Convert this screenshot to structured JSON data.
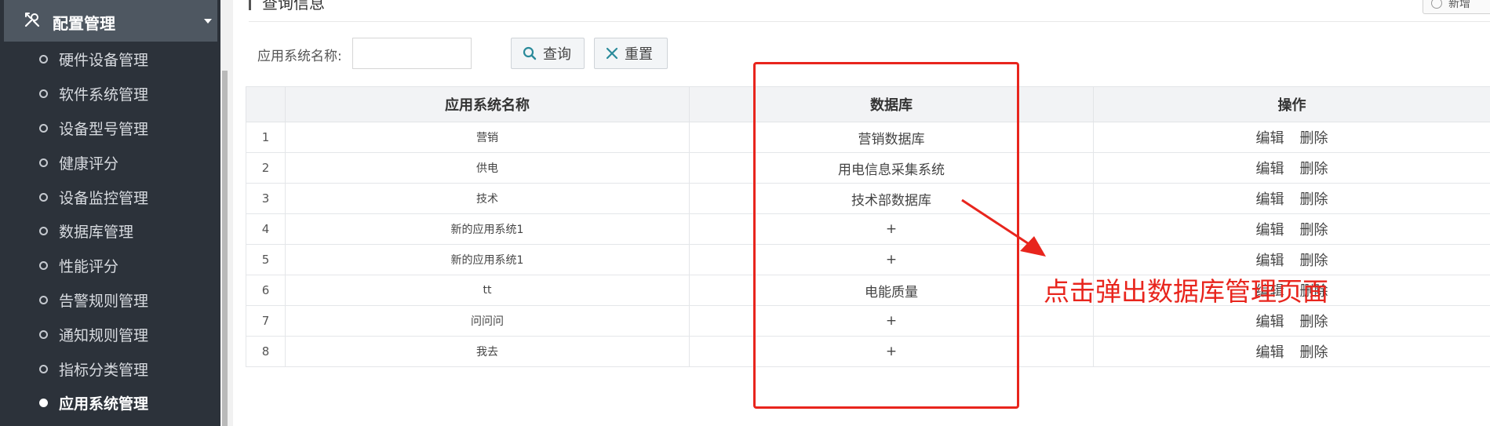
{
  "sidebar": {
    "header_label": "配置管理",
    "items": [
      {
        "label": "硬件设备管理",
        "active": false
      },
      {
        "label": "软件系统管理",
        "active": false
      },
      {
        "label": "设备型号管理",
        "active": false
      },
      {
        "label": "健康评分",
        "active": false
      },
      {
        "label": "设备监控管理",
        "active": false
      },
      {
        "label": "数据库管理",
        "active": false
      },
      {
        "label": "性能评分",
        "active": false
      },
      {
        "label": "告警规则管理",
        "active": false
      },
      {
        "label": "通知规则管理",
        "active": false
      },
      {
        "label": "指标分类管理",
        "active": false
      },
      {
        "label": "应用系统管理",
        "active": true
      }
    ]
  },
  "main": {
    "section_title": "查询信息",
    "add_label": "新增",
    "search": {
      "label": "应用系统名称:",
      "value": "",
      "placeholder": ""
    },
    "query_label": "查询",
    "reset_label": "重置"
  },
  "table": {
    "headers": [
      "",
      "应用系统名称",
      "数据库",
      "操作"
    ],
    "rows": [
      {
        "idx": "1",
        "name": "营销",
        "db": "营销数据库"
      },
      {
        "idx": "2",
        "name": "供电",
        "db": "用电信息采集系统"
      },
      {
        "idx": "3",
        "name": "技术",
        "db": "技术部数据库"
      },
      {
        "idx": "4",
        "name": "新的应用系统1",
        "db": "+"
      },
      {
        "idx": "5",
        "name": "新的应用系统1",
        "db": "+"
      },
      {
        "idx": "6",
        "name": "tt",
        "db": "电能质量"
      },
      {
        "idx": "7",
        "name": "问问问",
        "db": "+"
      },
      {
        "idx": "8",
        "name": "我去",
        "db": "+"
      }
    ],
    "edit_label": "编辑",
    "delete_label": "删除"
  },
  "annotation": {
    "text": "点击弹出数据库管理页面",
    "color": "#e8251d"
  },
  "colors": {
    "sidebar_bg": "#2c323a",
    "sidebar_header_bg": "#4e5761",
    "annotation_red": "#e8251d"
  }
}
